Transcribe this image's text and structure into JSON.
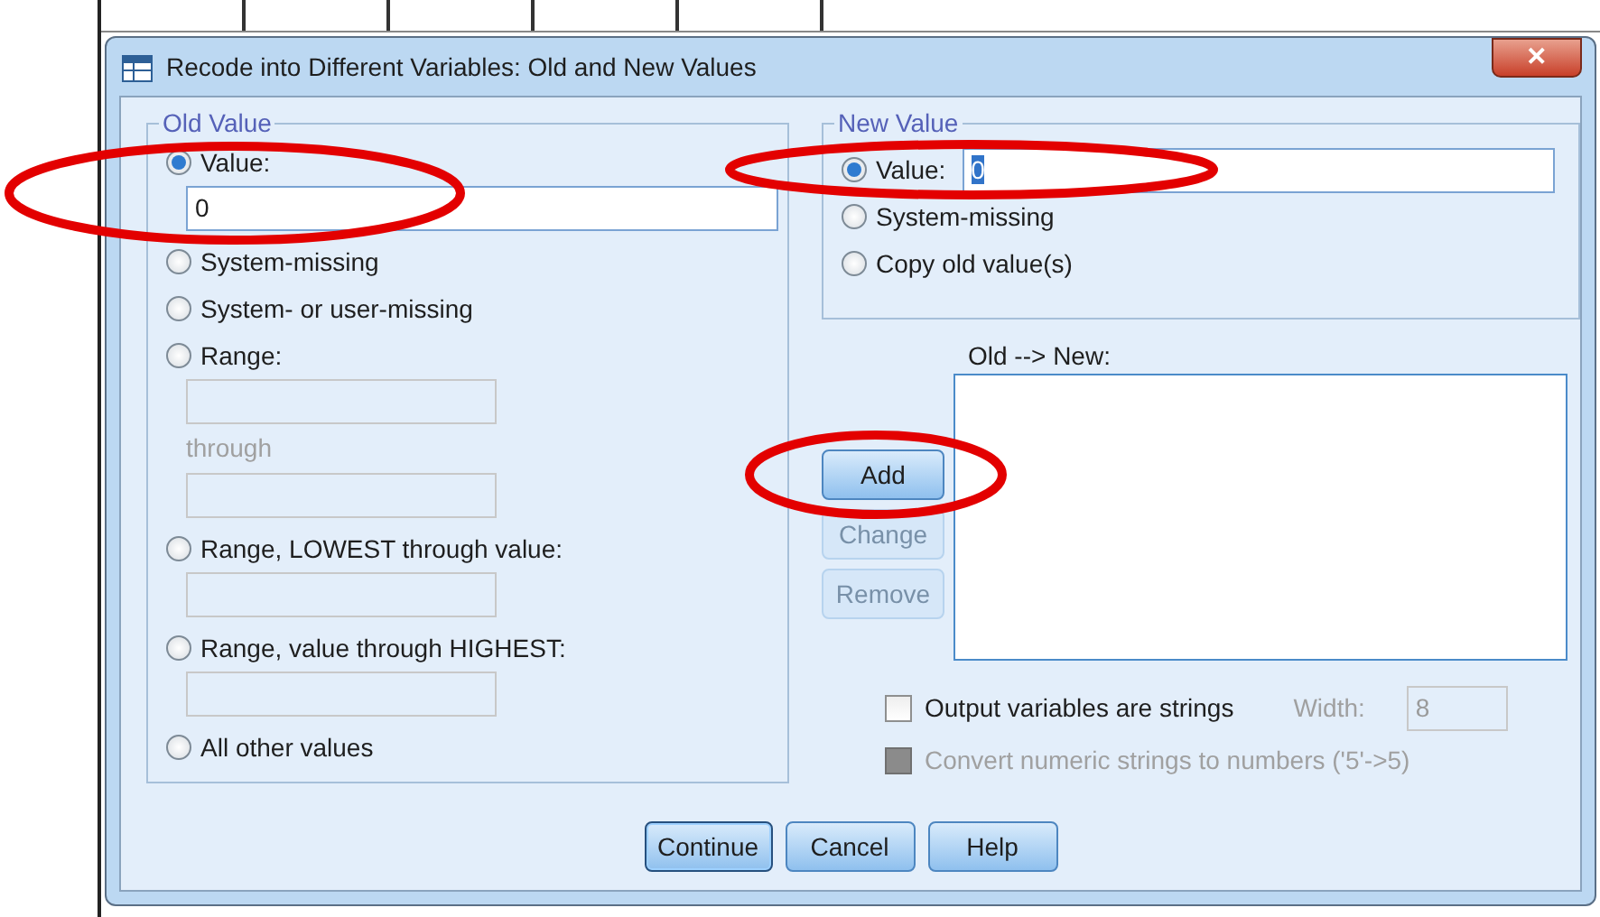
{
  "window": {
    "title": "Recode into Different Variables: Old and New Values",
    "close": "✕"
  },
  "old_value": {
    "legend": "Old Value",
    "options": [
      {
        "kind": "value",
        "label": "Value:",
        "selected": true,
        "fields": [
          {
            "value": "0",
            "disabled": false
          }
        ]
      },
      {
        "kind": "plain",
        "label": "System-missing",
        "selected": false
      },
      {
        "kind": "plain",
        "label": "System- or user-missing",
        "selected": false
      },
      {
        "kind": "range",
        "label": "Range:",
        "selected": false,
        "through": "through",
        "fields": [
          {
            "disabled": true
          },
          {
            "disabled": true
          }
        ]
      },
      {
        "kind": "value",
        "label": "Range, LOWEST through value:",
        "selected": false,
        "fields": [
          {
            "disabled": true
          }
        ]
      },
      {
        "kind": "value",
        "label": "Range, value through HIGHEST:",
        "selected": false,
        "fields": [
          {
            "disabled": true
          }
        ]
      },
      {
        "kind": "plain",
        "label": "All other values",
        "selected": false
      }
    ]
  },
  "new_value": {
    "legend": "New Value",
    "options": [
      {
        "kind": "inline",
        "label": "Value:",
        "selected": true,
        "field": {
          "value": "0",
          "highlighted": true
        }
      },
      {
        "kind": "plain",
        "label": "System-missing",
        "selected": false
      },
      {
        "kind": "plain",
        "label": "Copy old value(s)",
        "selected": false
      }
    ]
  },
  "mapping": {
    "label": "Old --> New:"
  },
  "actions": [
    {
      "label": "Add",
      "disabled": false
    },
    {
      "label": "Change",
      "disabled": true
    },
    {
      "label": "Remove",
      "disabled": true
    }
  ],
  "options": [
    {
      "label": "Output variables are strings",
      "checked": false,
      "disabled": false,
      "width_label": "Width:",
      "width_value": "8"
    },
    {
      "label": "Convert numeric strings to numbers ('5'->5)",
      "checked": false,
      "disabled": true
    }
  ],
  "footer_buttons": [
    {
      "label": "Continue",
      "default": true
    },
    {
      "label": "Cancel",
      "default": false
    },
    {
      "label": "Help",
      "default": false
    }
  ],
  "highlights": [
    {
      "kind": "ellipse"
    },
    {
      "kind": "ellipse"
    },
    {
      "kind": "ellipse"
    }
  ]
}
